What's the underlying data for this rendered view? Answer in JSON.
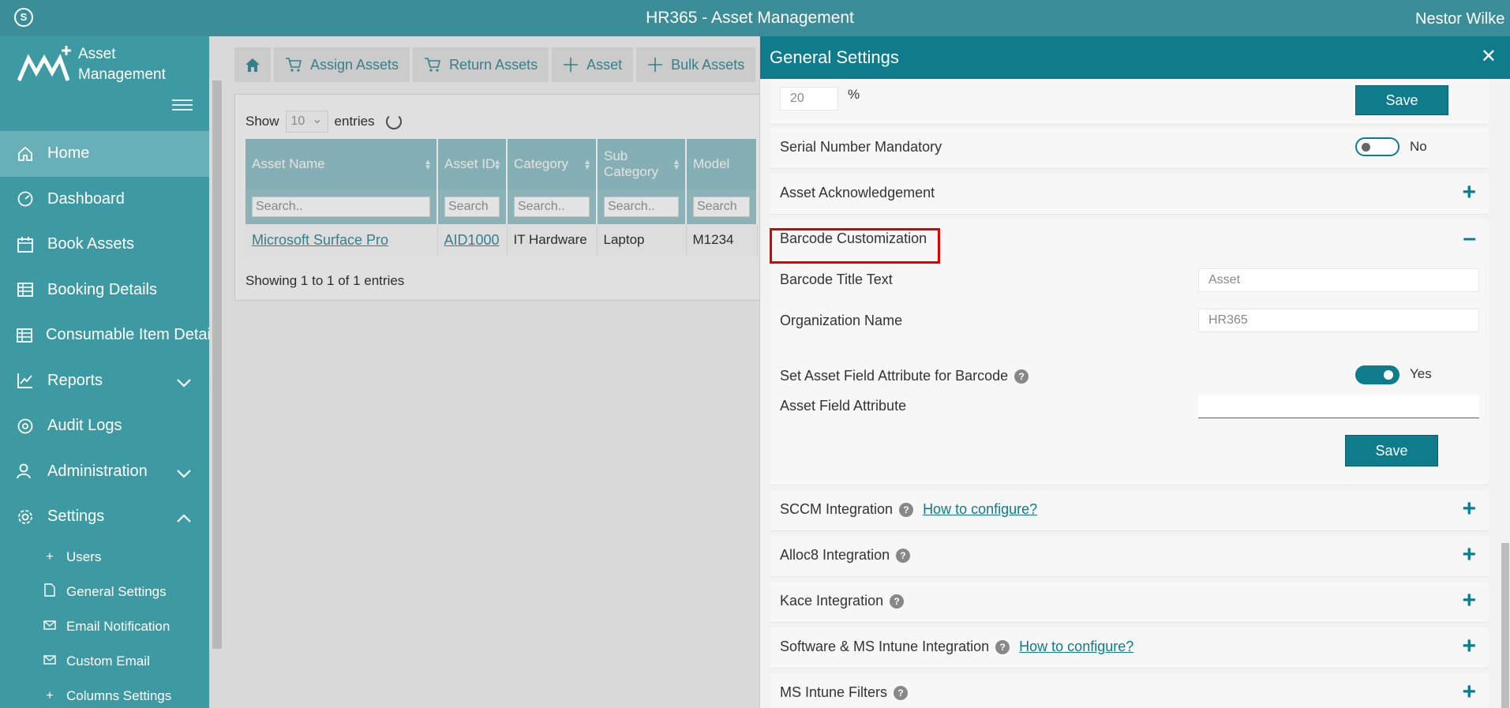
{
  "topbar": {
    "title": "HR365 - Asset Management",
    "user": "Nestor Wilke"
  },
  "sidebar": {
    "logo_line1": "Asset",
    "logo_line2": "Management",
    "items": [
      {
        "label": "Home",
        "icon": "home-icon"
      },
      {
        "label": "Dashboard",
        "icon": "dashboard-icon"
      },
      {
        "label": "Book Assets",
        "icon": "calendar-icon"
      },
      {
        "label": "Booking Details",
        "icon": "table-icon"
      },
      {
        "label": "Consumable Item Detai",
        "icon": "table-icon"
      },
      {
        "label": "Reports",
        "icon": "chart-icon"
      },
      {
        "label": "Audit Logs",
        "icon": "audit-icon"
      },
      {
        "label": "Administration",
        "icon": "user-icon"
      },
      {
        "label": "Settings",
        "icon": "gear-icon"
      }
    ],
    "sub_items": [
      {
        "label": "Users",
        "icon": "plus-icon"
      },
      {
        "label": "General Settings",
        "icon": "document-icon"
      },
      {
        "label": "Email Notification",
        "icon": "mail-icon"
      },
      {
        "label": "Custom Email",
        "icon": "mail-icon"
      },
      {
        "label": "Columns Settings",
        "icon": "plus-icon"
      }
    ]
  },
  "toolbar": {
    "assign": "Assign Assets",
    "return": "Return Assets",
    "asset": "Asset",
    "bulk": "Bulk Assets"
  },
  "grid": {
    "show_label": "Show",
    "show_value": "10",
    "entries_label": "entries",
    "columns": [
      "Asset Name",
      "Asset ID",
      "Category",
      "Sub Category",
      "Model"
    ],
    "filter_placeholders": [
      "Search..",
      "Search",
      "Search..",
      "Search..",
      "Search"
    ],
    "rows": [
      [
        "Microsoft Surface Pro",
        "AID1000",
        "IT Hardware",
        "Laptop",
        "M1234"
      ]
    ],
    "footer": "Showing 1 to 1 of 1 entries"
  },
  "panel": {
    "title": "General Settings",
    "threshold_value": "20",
    "threshold_unit": "%",
    "save_label": "Save",
    "serial_label": "Serial Number Mandatory",
    "serial_toggle": "No",
    "ack_label": "Asset Acknowledgement",
    "barcode_label": "Barcode Customization",
    "barcode_title_label": "Barcode Title Text",
    "barcode_title_value": "Asset",
    "org_name_label": "Organization Name",
    "org_name_value": "HR365",
    "set_attr_label": "Set Asset Field Attribute for Barcode",
    "set_attr_toggle": "Yes",
    "field_attr_label": "Asset Field Attribute",
    "field_attr_value": "",
    "save2_label": "Save",
    "sccm_label": "SCCM Integration",
    "sccm_link": "How to configure?",
    "alloc8_label": "Alloc8 Integration",
    "kace_label": "Kace Integration",
    "intune_label": "Software & MS Intune Integration",
    "intune_link": "How to configure?",
    "filters_label": "MS Intune Filters"
  },
  "colors": {
    "accent": "#0e7c8b",
    "sidebar": "#3d9aa2",
    "highlight": "#e00000"
  }
}
